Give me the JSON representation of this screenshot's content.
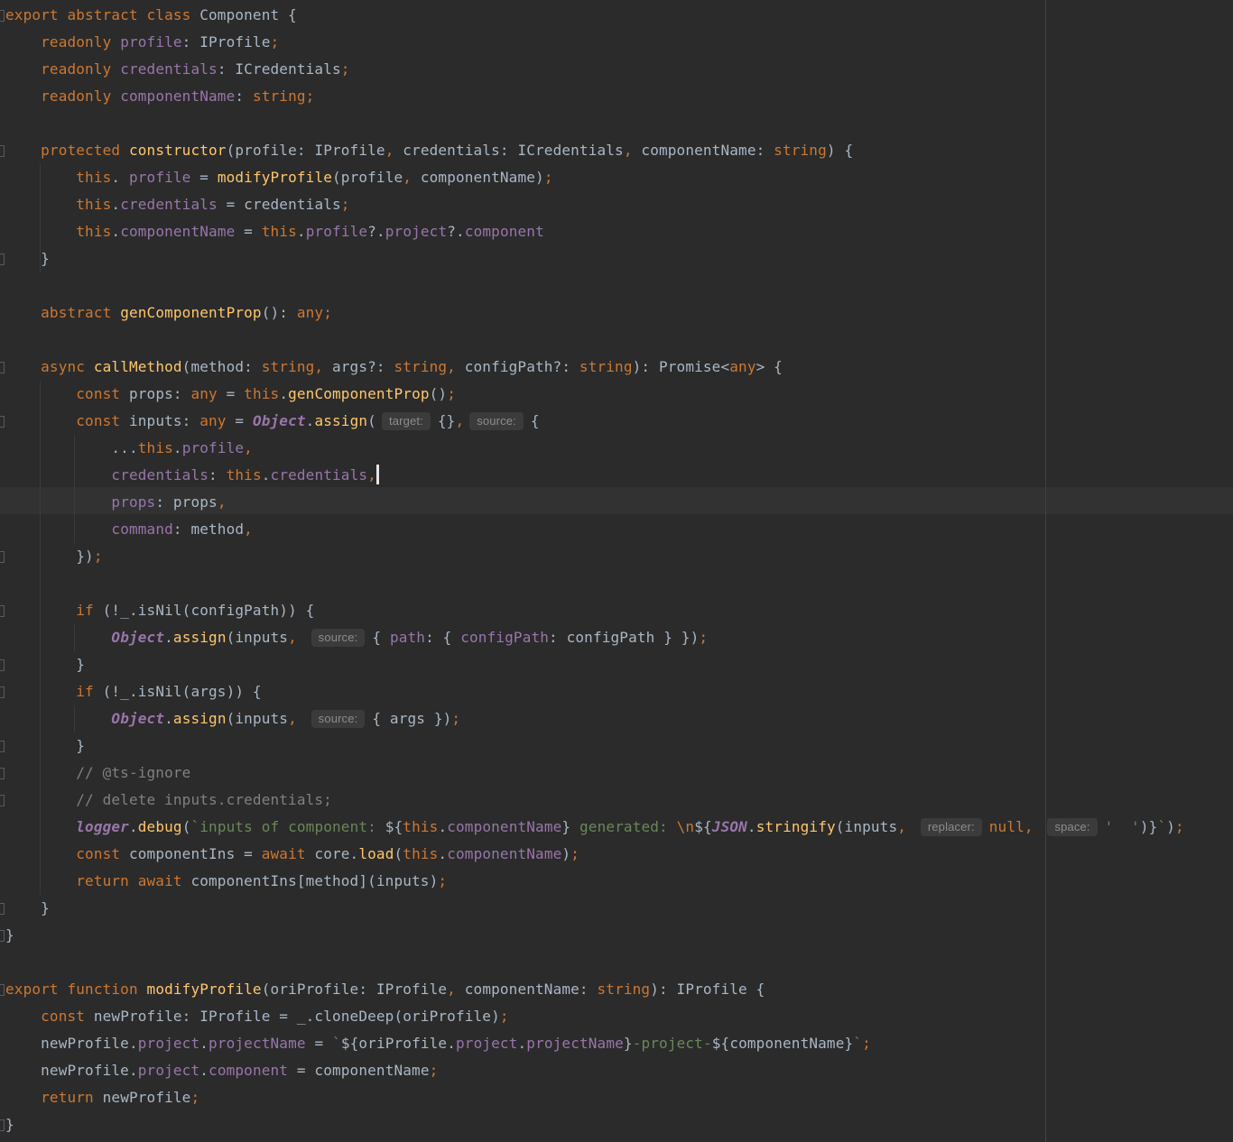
{
  "editor": {
    "language": "TypeScript",
    "colors": {
      "background": "#2b2b2b",
      "text": "#a9b7c6",
      "keyword": "#cc7832",
      "function": "#ffc66d",
      "property": "#9876aa",
      "string": "#6a8759",
      "comment": "#808080",
      "caret_line": "#323232"
    },
    "caret_line": 18,
    "lines": [
      [
        [
          "k",
          "export abstract class "
        ],
        [
          "",
          "Component {"
        ]
      ],
      [
        [
          "",
          "    "
        ],
        [
          "k",
          "readonly "
        ],
        [
          "p",
          "profile"
        ],
        [
          "",
          ": IProfile"
        ],
        [
          "k",
          ";"
        ]
      ],
      [
        [
          "",
          "    "
        ],
        [
          "k",
          "readonly "
        ],
        [
          "p",
          "credentials"
        ],
        [
          "",
          ": ICredentials"
        ],
        [
          "k",
          ";"
        ]
      ],
      [
        [
          "",
          "    "
        ],
        [
          "k",
          "readonly "
        ],
        [
          "p",
          "componentName"
        ],
        [
          "",
          ": "
        ],
        [
          "k",
          "string;"
        ]
      ],
      [],
      [
        [
          "",
          "    "
        ],
        [
          "k",
          "protected "
        ],
        [
          "f",
          "constructor"
        ],
        [
          "",
          "(profile: IProfile"
        ],
        [
          "k",
          ", "
        ],
        [
          "",
          "credentials: ICredentials"
        ],
        [
          "k",
          ", "
        ],
        [
          "",
          "componentName: "
        ],
        [
          "k",
          "string"
        ],
        [
          "",
          ") {"
        ]
      ],
      [
        [
          "",
          "        "
        ],
        [
          "k",
          "this"
        ],
        [
          "",
          ". "
        ],
        [
          "p",
          "profile"
        ],
        [
          "",
          " = "
        ],
        [
          "f",
          "modifyProfile"
        ],
        [
          "",
          "(profile"
        ],
        [
          "k",
          ", "
        ],
        [
          "",
          "componentName)"
        ],
        [
          "k",
          ";"
        ]
      ],
      [
        [
          "",
          "        "
        ],
        [
          "k",
          "this"
        ],
        [
          "",
          "."
        ],
        [
          "p",
          "credentials"
        ],
        [
          "",
          " = credentials"
        ],
        [
          "k",
          ";"
        ]
      ],
      [
        [
          "",
          "        "
        ],
        [
          "k",
          "this"
        ],
        [
          "",
          "."
        ],
        [
          "p",
          "componentName"
        ],
        [
          "",
          " = "
        ],
        [
          "k",
          "this"
        ],
        [
          "",
          "."
        ],
        [
          "p",
          "profile"
        ],
        [
          "",
          "?."
        ],
        [
          "p",
          "project"
        ],
        [
          "",
          "?."
        ],
        [
          "p",
          "component"
        ]
      ],
      [
        [
          "",
          "    }"
        ]
      ],
      [],
      [
        [
          "",
          "    "
        ],
        [
          "k",
          "abstract "
        ],
        [
          "f",
          "genComponentProp"
        ],
        [
          "",
          "(): "
        ],
        [
          "k",
          "any;"
        ]
      ],
      [],
      [
        [
          "",
          "    "
        ],
        [
          "k",
          "async "
        ],
        [
          "f",
          "callMethod"
        ],
        [
          "",
          "(method: "
        ],
        [
          "k",
          "string, "
        ],
        [
          "",
          "args?: "
        ],
        [
          "k",
          "string, "
        ],
        [
          "",
          "configPath?: "
        ],
        [
          "k",
          "string"
        ],
        [
          "",
          "): Promise<"
        ],
        [
          "k",
          "any"
        ],
        [
          "",
          "> {"
        ]
      ],
      [
        [
          "",
          "        "
        ],
        [
          "k",
          "const "
        ],
        [
          "",
          "props: "
        ],
        [
          "k",
          "any "
        ],
        [
          "",
          "= "
        ],
        [
          "k",
          "this"
        ],
        [
          "",
          "."
        ],
        [
          "f",
          "genComponentProp"
        ],
        [
          "",
          "()"
        ],
        [
          "k",
          ";"
        ]
      ],
      [
        [
          "",
          "        "
        ],
        [
          "k",
          "const "
        ],
        [
          "",
          "inputs: "
        ],
        [
          "k",
          "any "
        ],
        [
          "",
          "= "
        ],
        [
          "it",
          "Object"
        ],
        [
          "",
          "."
        ],
        [
          "f",
          "assign"
        ],
        [
          "",
          "("
        ],
        [
          "hint",
          "target:"
        ],
        [
          "",
          "{}"
        ],
        [
          "k",
          ","
        ],
        [
          "hint",
          "source:"
        ],
        [
          "",
          "{"
        ]
      ],
      [
        [
          "",
          "            ..."
        ],
        [
          "k",
          "this"
        ],
        [
          "",
          "."
        ],
        [
          "p",
          "profile"
        ],
        [
          "k",
          ","
        ]
      ],
      [
        [
          "",
          "            "
        ],
        [
          "p",
          "credentials"
        ],
        [
          "",
          ": "
        ],
        [
          "k",
          "this"
        ],
        [
          "",
          "."
        ],
        [
          "p",
          "credentials"
        ],
        [
          "k",
          ","
        ],
        [
          "cursor",
          ""
        ]
      ],
      [
        [
          "",
          "            "
        ],
        [
          "p",
          "props"
        ],
        [
          "",
          ": props"
        ],
        [
          "k",
          ","
        ]
      ],
      [
        [
          "",
          "            "
        ],
        [
          "p",
          "command"
        ],
        [
          "",
          ": method"
        ],
        [
          "k",
          ","
        ]
      ],
      [
        [
          "",
          "        })"
        ],
        [
          "k",
          ";"
        ]
      ],
      [],
      [
        [
          "",
          "        "
        ],
        [
          "k",
          "if "
        ],
        [
          "",
          "(!_.isNil(configPath)) {"
        ]
      ],
      [
        [
          "",
          "            "
        ],
        [
          "it",
          "Object"
        ],
        [
          "",
          "."
        ],
        [
          "f",
          "assign"
        ],
        [
          "",
          "(inputs"
        ],
        [
          "k",
          ", "
        ],
        [
          "hint",
          "source:"
        ],
        [
          "",
          "{ "
        ],
        [
          "p",
          "path"
        ],
        [
          "",
          ": { "
        ],
        [
          "p",
          "configPath"
        ],
        [
          "",
          ": configPath } })"
        ],
        [
          "k",
          ";"
        ]
      ],
      [
        [
          "",
          "        }"
        ]
      ],
      [
        [
          "",
          "        "
        ],
        [
          "k",
          "if "
        ],
        [
          "",
          "(!_.isNil(args)) {"
        ]
      ],
      [
        [
          "",
          "            "
        ],
        [
          "it",
          "Object"
        ],
        [
          "",
          "."
        ],
        [
          "f",
          "assign"
        ],
        [
          "",
          "(inputs"
        ],
        [
          "k",
          ", "
        ],
        [
          "hint",
          "source:"
        ],
        [
          "",
          "{ args })"
        ],
        [
          "k",
          ";"
        ]
      ],
      [
        [
          "",
          "        }"
        ]
      ],
      [
        [
          "",
          "        "
        ],
        [
          "c",
          "// @ts-ignore"
        ]
      ],
      [
        [
          "",
          "        "
        ],
        [
          "c",
          "// delete inputs.credentials;"
        ]
      ],
      [
        [
          "",
          "        "
        ],
        [
          "it",
          "logger"
        ],
        [
          "",
          "."
        ],
        [
          "f",
          "debug"
        ],
        [
          "",
          "("
        ],
        [
          "s",
          "`inputs of component: "
        ],
        [
          "",
          "${"
        ],
        [
          "k",
          "this"
        ],
        [
          "",
          "."
        ],
        [
          "p",
          "componentName"
        ],
        [
          "",
          "}"
        ],
        [
          "s",
          " generated: "
        ],
        [
          "k",
          "\\n"
        ],
        [
          "",
          "${"
        ],
        [
          "it",
          "JSON"
        ],
        [
          "",
          "."
        ],
        [
          "f",
          "stringify"
        ],
        [
          "",
          "(inputs"
        ],
        [
          "k",
          ", "
        ],
        [
          "hint",
          "replacer:"
        ],
        [
          "k",
          "null, "
        ],
        [
          "hint",
          "space:"
        ],
        [
          "s",
          "'  '"
        ],
        [
          "",
          ")}"
        ],
        [
          "s",
          "`"
        ],
        [
          "",
          ")"
        ],
        [
          "k",
          ";"
        ]
      ],
      [
        [
          "",
          "        "
        ],
        [
          "k",
          "const "
        ],
        [
          "",
          "componentIns = "
        ],
        [
          "k",
          "await "
        ],
        [
          "",
          "core."
        ],
        [
          "f",
          "load"
        ],
        [
          "",
          "("
        ],
        [
          "k",
          "this"
        ],
        [
          "",
          "."
        ],
        [
          "p",
          "componentName"
        ],
        [
          "",
          ")"
        ],
        [
          "k",
          ";"
        ]
      ],
      [
        [
          "",
          "        "
        ],
        [
          "k",
          "return await "
        ],
        [
          "",
          "componentIns[method](inputs)"
        ],
        [
          "k",
          ";"
        ]
      ],
      [
        [
          "",
          "    }"
        ]
      ],
      [
        [
          "",
          "}"
        ]
      ],
      [],
      [
        [
          "k",
          "export function "
        ],
        [
          "f",
          "modifyProfile"
        ],
        [
          "",
          "(oriProfile: IProfile"
        ],
        [
          "k",
          ", "
        ],
        [
          "",
          "componentName: "
        ],
        [
          "k",
          "string"
        ],
        [
          "",
          "): IProfile {"
        ]
      ],
      [
        [
          "",
          "    "
        ],
        [
          "k",
          "const "
        ],
        [
          "",
          "newProfile: IProfile = _.cloneDeep(oriProfile)"
        ],
        [
          "k",
          ";"
        ]
      ],
      [
        [
          "",
          "    newProfile."
        ],
        [
          "p",
          "project"
        ],
        [
          "",
          "."
        ],
        [
          "p",
          "projectName"
        ],
        [
          "",
          " = "
        ],
        [
          "s",
          "`"
        ],
        [
          "",
          "${oriProfile."
        ],
        [
          "p",
          "project"
        ],
        [
          "",
          "."
        ],
        [
          "p",
          "projectName"
        ],
        [
          "",
          "}"
        ],
        [
          "s",
          "-project-"
        ],
        [
          "",
          "${componentName}"
        ],
        [
          "s",
          "`"
        ],
        [
          "k",
          ";"
        ]
      ],
      [
        [
          "",
          "    newProfile."
        ],
        [
          "p",
          "project"
        ],
        [
          "",
          "."
        ],
        [
          "p",
          "component"
        ],
        [
          "",
          " = componentName"
        ],
        [
          "k",
          ";"
        ]
      ],
      [
        [
          "",
          "    "
        ],
        [
          "k",
          "return "
        ],
        [
          "",
          "newProfile"
        ],
        [
          "k",
          ";"
        ]
      ],
      [
        [
          "",
          "}"
        ]
      ]
    ]
  }
}
